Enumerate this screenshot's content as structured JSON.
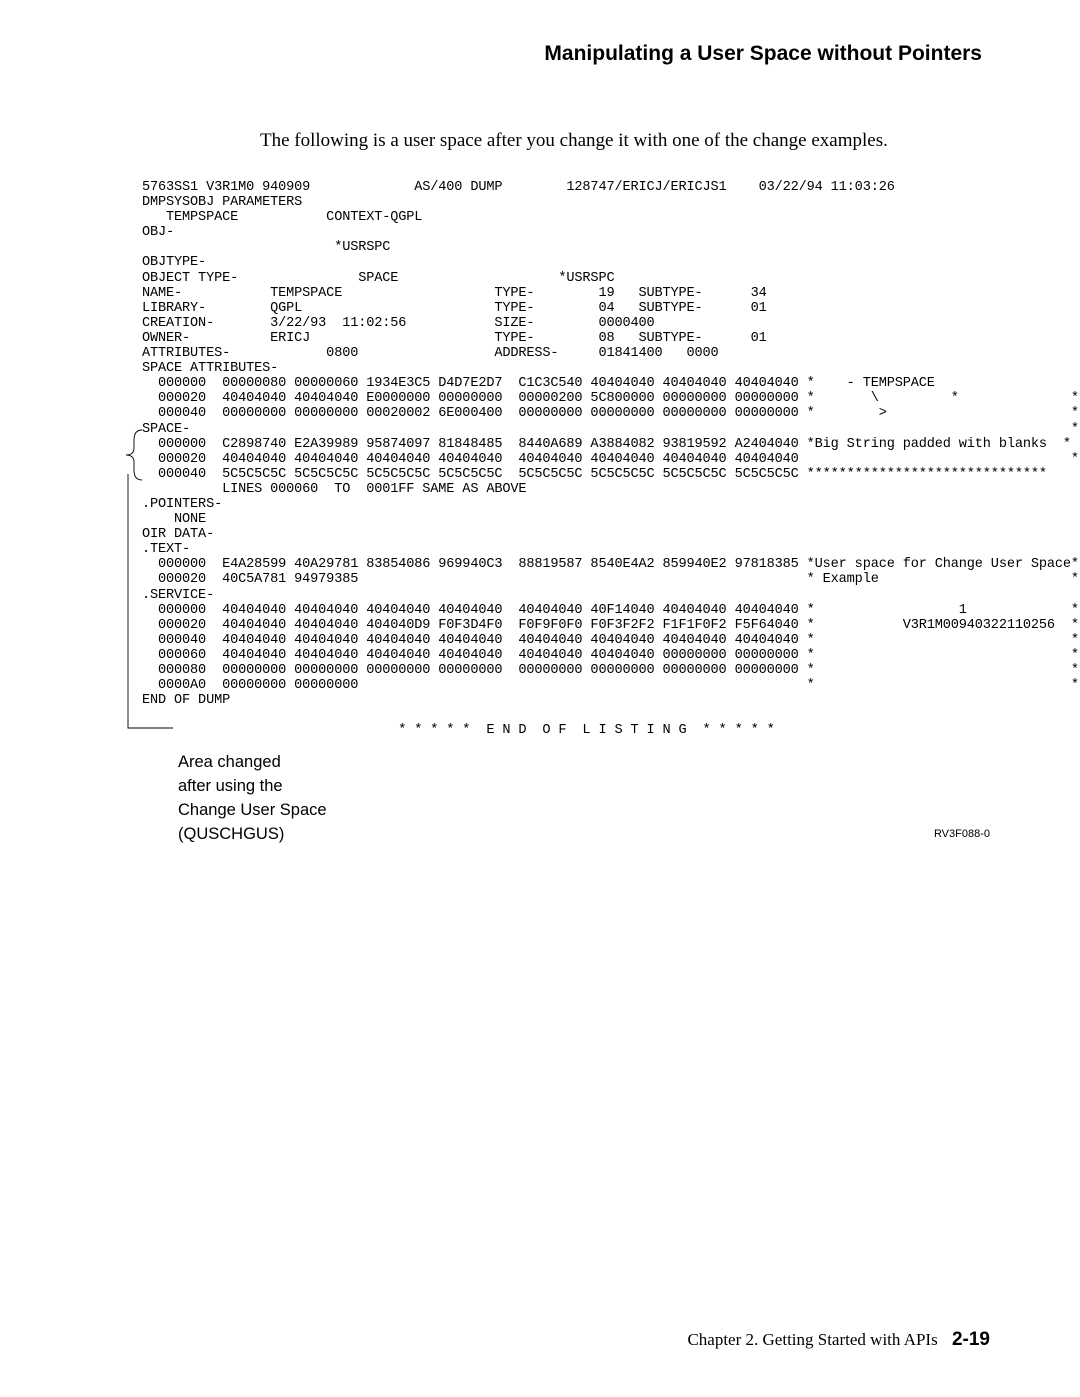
{
  "heading": "Manipulating a User Space without Pointers",
  "intro": "The following is a user space after you change it with one of the change examples.",
  "dump": " 5763SS1 V3R1M0 940909             AS/400 DUMP        128747/ERICJ/ERICJS1    03/22/94 11:03:26\n DMPSYSOBJ PARAMETERS\n    TEMPSPACE           CONTEXT-QGPL\n OBJ-\n                         *USRSPC\n OBJTYPE-\n OBJECT TYPE-               SPACE                    *USRSPC\n NAME-           TEMPSPACE                   TYPE-        19   SUBTYPE-      34\n LIBRARY-        QGPL                        TYPE-        04   SUBTYPE-      01\n CREATION-       3/22/93  11:02:56           SIZE-        0000400\n OWNER-          ERICJ                       TYPE-        08   SUBTYPE-      01\n ATTRIBUTES-            0800                 ADDRESS-     01841400   0000\n SPACE ATTRIBUTES-\n   000000  00000080 00000060 1934E3C5 D4D7E2D7  C1C3C540 40404040 40404040 40404040 *    - TEMPSPACE                  \n   000020  40404040 40404040 E0000000 00000000  00000200 5C800000 00000000 00000000 *       \\         *              *\n   000040  00000000 00000000 00020002 6E000400  00000000 00000000 00000000 00000000 *        >                       *\n SPACE-                                                                                                              *\n   000000  C2898740 E2A39989 95874097 81848485  8440A689 A3884082 93819592 A2404040 *Big String padded with blanks  *\n   000020  40404040 40404040 40404040 40404040  40404040 40404040 40404040 40404040                                  *\n   000040  5C5C5C5C 5C5C5C5C 5C5C5C5C 5C5C5C5C  5C5C5C5C 5C5C5C5C 5C5C5C5C 5C5C5C5C ******************************\n           LINES 000060  TO  0001FF SAME AS ABOVE\n .POINTERS-\n     NONE\n OIR DATA-\n .TEXT-\n   000000  E4A28599 40A29781 83854086 969940C3  88819587 8540E4A2 859940E2 97818385 *User space for Change User Space*\n   000020  40C5A781 94979385                                                        * Example                        *\n .SERVICE-\n   000000  40404040 40404040 40404040 40404040  40404040 40F14040 40404040 40404040 *                  1             *\n   000020  40404040 40404040 404040D9 F0F3D4F0  F0F9F0F0 F0F3F2F2 F1F1F0F2 F5F64040 *           V3R1M00940322110256  *\n   000040  40404040 40404040 40404040 40404040  40404040 40404040 40404040 40404040 *                                *\n   000060  40404040 40404040 40404040 40404040  40404040 40404040 00000000 00000000 *                                *\n   000080  00000000 00000000 00000000 00000000  00000000 00000000 00000000 00000000 *                                *\n   0000A0  00000000 00000000                                                        *                                *\n END OF DUMP\n\n                                 * * * * *  E N D  O F  L I S T I N G  * * * * *",
  "caption_l1": "Area changed",
  "caption_l2": "after using the",
  "caption_l3": "Change User Space",
  "caption_l4": "(QUSCHGUS)",
  "figref": "RV3F088-0",
  "footer_text": "Chapter 2.  Getting Started with APIs",
  "footer_page": "2-19"
}
